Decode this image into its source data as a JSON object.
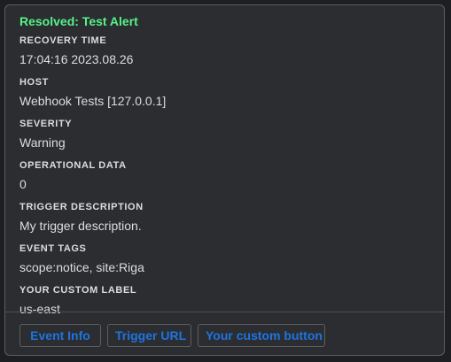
{
  "embed": {
    "title": "Resolved: Test Alert",
    "title_color": "#57f287",
    "fields": [
      {
        "name": "RECOVERY TIME",
        "value": "17:04:16 2023.08.26"
      },
      {
        "name": "HOST",
        "value": "Webhook Tests [127.0.0.1]"
      },
      {
        "name": "SEVERITY",
        "value": "Warning"
      },
      {
        "name": "OPERATIONAL DATA",
        "value": "0"
      },
      {
        "name": "TRIGGER DESCRIPTION",
        "value": "My trigger description."
      },
      {
        "name": "EVENT TAGS",
        "value": "scope:notice, site:Riga"
      },
      {
        "name": "YOUR CUSTOM LABEL",
        "value": "us-east"
      }
    ]
  },
  "buttons": {
    "event_info": "Event Info",
    "trigger_url": "Trigger URL",
    "custom": "Your custom button",
    "link_color": "#1e74e0"
  }
}
